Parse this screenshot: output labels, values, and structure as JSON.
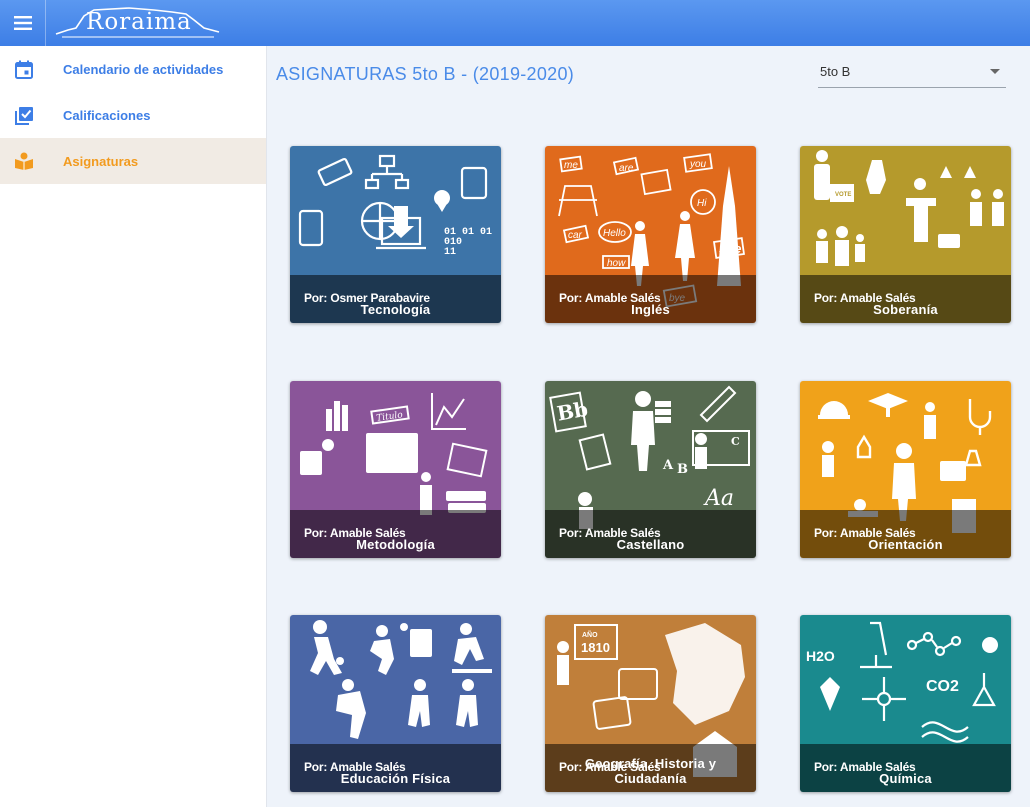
{
  "app": {
    "logo_text": "Roraima"
  },
  "sidebar": {
    "items": [
      {
        "label": "Calendario de actividades",
        "icon": "calendar-icon"
      },
      {
        "label": "Calificaciones",
        "icon": "checklist-icon"
      },
      {
        "label": "Asignaturas",
        "icon": "book-reader-icon"
      }
    ]
  },
  "main": {
    "title": "ASIGNATURAS 5to B - (2019-2020)",
    "section_select": {
      "value": "5to B"
    }
  },
  "colors": {
    "accent": "#3d7ee6",
    "active": "#f29b1f",
    "card_tecnologia": "#3d74a8",
    "card_ingles": "#e06a1c",
    "card_soberania": "#b59a2c",
    "card_metodologia": "#8a5599",
    "card_castellano": "#566a50",
    "card_orientacion": "#f0a21a",
    "card_educacion_fisica": "#4a66a6",
    "card_geografia": "#c07f3a",
    "card_quimica": "#1a8a8e"
  },
  "cards": [
    {
      "teacher": "Por: Osmer Parabavire",
      "subject": "Tecnología"
    },
    {
      "teacher": "Por: Amable Salés",
      "subject": "Inglés"
    },
    {
      "teacher": "Por: Amable Salés",
      "subject": "Soberanía"
    },
    {
      "teacher": "Por: Amable Salés",
      "subject": "Metodología"
    },
    {
      "teacher": "Por: Amable Salés",
      "subject": "Castellano"
    },
    {
      "teacher": "Por: Amable Salés",
      "subject": "Orientación"
    },
    {
      "teacher": "Por: Amable Salés",
      "subject": "Educación Física"
    },
    {
      "teacher": "Por: Amable Salés",
      "subject_line1": "Geografía, Historia y",
      "subject_line2": "Ciudadanía"
    },
    {
      "teacher": "Por: Amable Salés",
      "subject": "Química"
    }
  ],
  "card_art": {
    "ingles_words": [
      "me",
      "are",
      "you",
      "Hi",
      "Hello",
      "car",
      "how",
      "she",
      "bye"
    ],
    "metodologia_words": [
      "Titulo"
    ],
    "castellano_words": [
      "Bb",
      "A",
      "B",
      "C",
      "Aa"
    ],
    "geografia_words": [
      "AÑO",
      "1810"
    ],
    "quimica_words": [
      "H2O",
      "CO2"
    ],
    "tecnologia_words": [
      "01 01 01",
      "010",
      "11"
    ],
    "soberania_words": [
      "VOTE"
    ]
  }
}
